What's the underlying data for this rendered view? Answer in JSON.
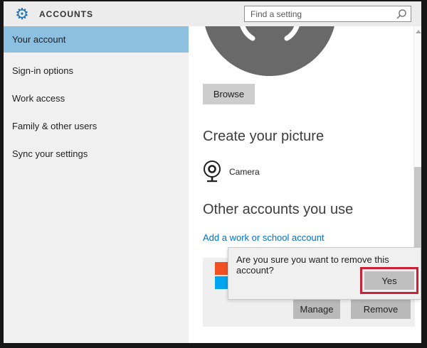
{
  "header": {
    "title": "ACCOUNTS",
    "search": {
      "placeholder": "Find a setting",
      "icon": "search-icon"
    },
    "app_icon": "gear-icon"
  },
  "sidebar": {
    "items": [
      {
        "label": "Your account",
        "selected": true
      },
      {
        "label": "Sign-in options",
        "selected": false
      },
      {
        "label": "Work access",
        "selected": false
      },
      {
        "label": "Family & other users",
        "selected": false
      },
      {
        "label": "Sync your settings",
        "selected": false
      }
    ]
  },
  "main": {
    "avatar": "default-user-avatar",
    "browse_label": "Browse",
    "create_picture_heading": "Create your picture",
    "camera_label": "Camera",
    "other_accounts_heading": "Other accounts you use",
    "add_account_link": "Add a work or school account",
    "account_logo": "microsoft-logo",
    "manage_label": "Manage",
    "remove_label": "Remove"
  },
  "dialog": {
    "message": "Are you sure you want to remove this account?",
    "yes_label": "Yes"
  },
  "colors": {
    "accent_blue": "#2173b8",
    "selected_item_bg": "#8dbfe1",
    "link_blue": "#0070c9",
    "annotation_red": "#cb2135",
    "avatar_gray": "#696969",
    "ms_red": "#f25022",
    "ms_green": "#7fba00",
    "ms_blue": "#00a4ef",
    "ms_yellow": "#ffb900"
  }
}
